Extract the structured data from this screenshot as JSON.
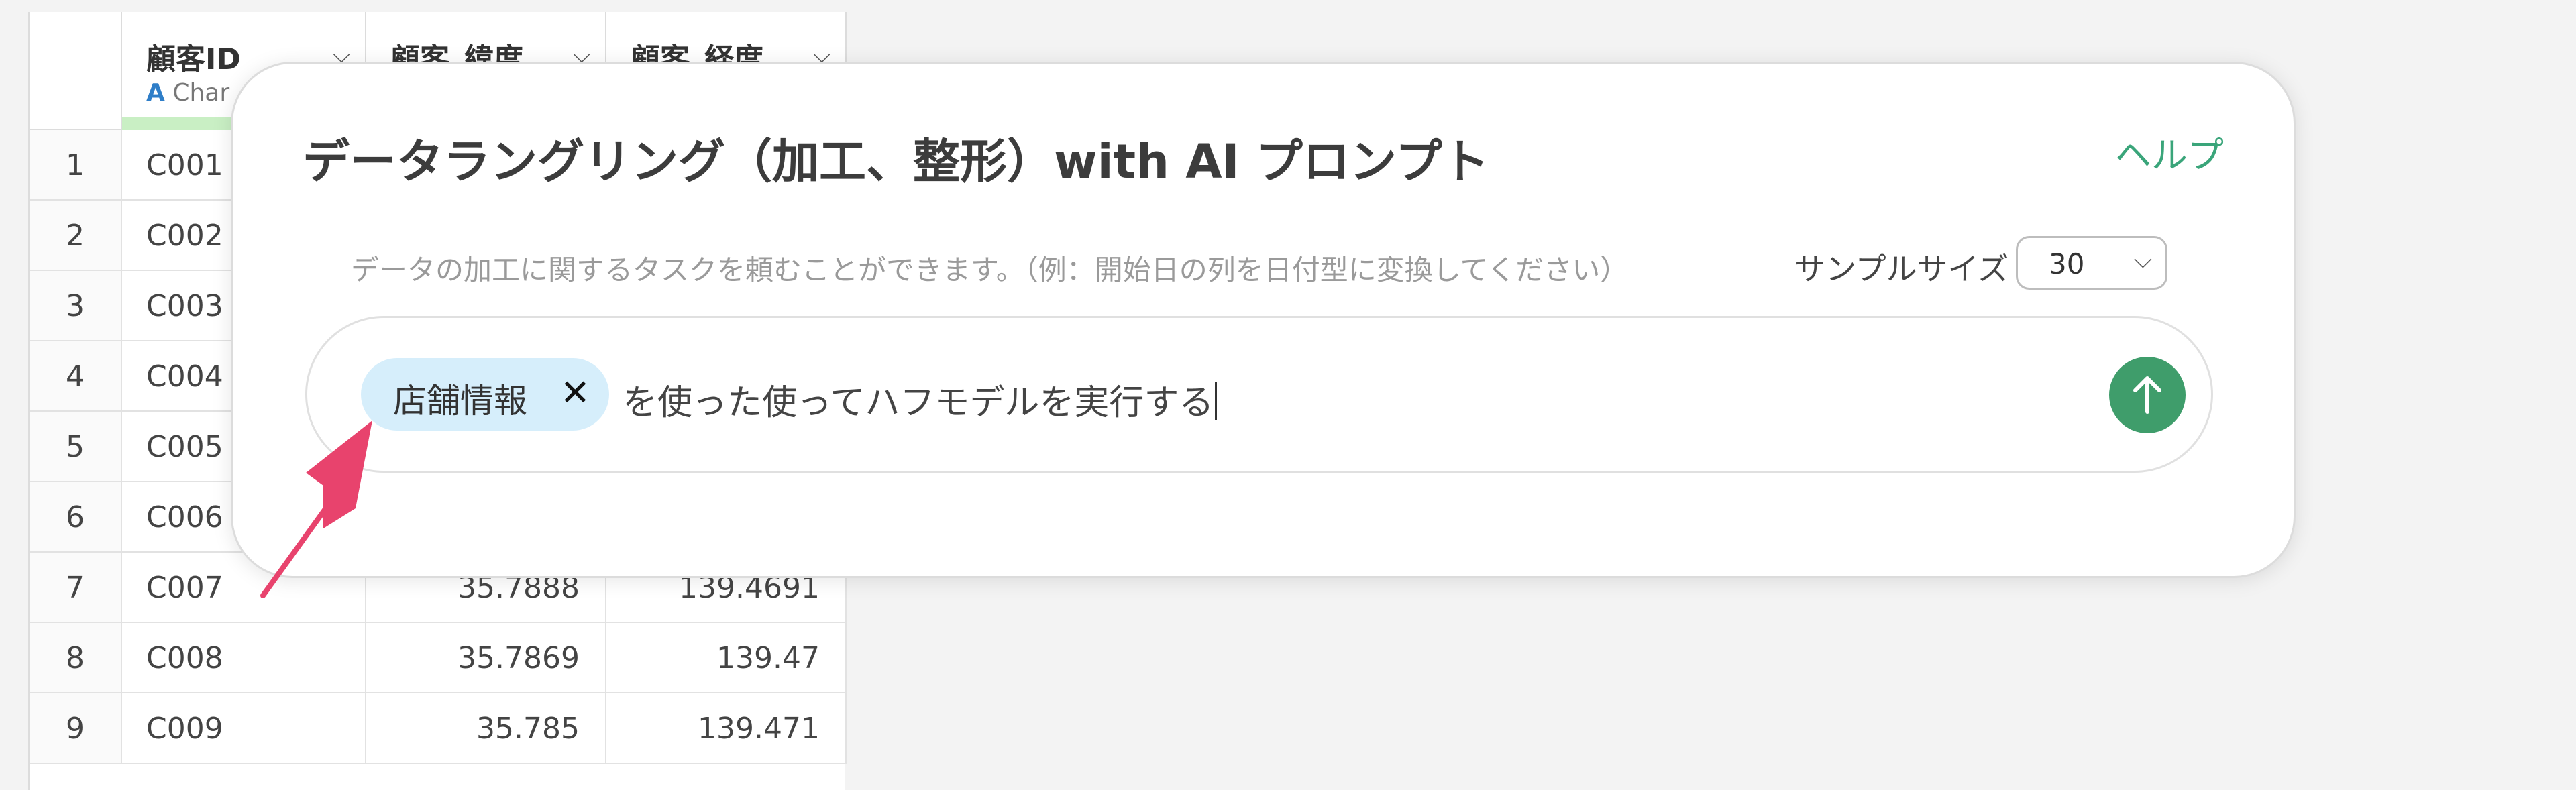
{
  "table": {
    "columns": [
      {
        "name": "顧客ID",
        "type_label": "Char"
      },
      {
        "name": "顧客_緯度"
      },
      {
        "name": "顧客_経度"
      }
    ],
    "rows": [
      {
        "n": "1",
        "id": "C001"
      },
      {
        "n": "2",
        "id": "C002"
      },
      {
        "n": "3",
        "id": "C003"
      },
      {
        "n": "4",
        "id": "C004"
      },
      {
        "n": "5",
        "id": "C005"
      },
      {
        "n": "6",
        "id": "C006"
      },
      {
        "n": "7",
        "id": "C007",
        "lat": "35.7888",
        "lng": "139.4691"
      },
      {
        "n": "8",
        "id": "C008",
        "lat": "35.7869",
        "lng": "139.47"
      },
      {
        "n": "9",
        "id": "C009",
        "lat": "35.785",
        "lng": "139.471"
      }
    ]
  },
  "dialog": {
    "title": "データラングリング（加工、整形）with AI プロンプト",
    "help_label": "ヘルプ",
    "hint": "データの加工に関するタスクを頼むことができます。（例：開始日の列を日付型に変換してください）",
    "sample_size_label": "サンプルサイズ",
    "sample_size_value": "30",
    "chip_label": "店舗情報",
    "chip_remove": "✕",
    "prompt_text": "を使った使ってハフモデルを実行する"
  },
  "colors": {
    "accent_green": "#3f9d6b",
    "help_link": "#3aa57a",
    "chip_bg": "#d6eefb",
    "annotation_arrow": "#e8436d",
    "type_icon": "#2f7ec8"
  },
  "icons": {
    "column_menu": "chevron-down-icon",
    "type": "text-type-icon",
    "send": "arrow-up-icon",
    "annotation": "pointer-arrow"
  }
}
